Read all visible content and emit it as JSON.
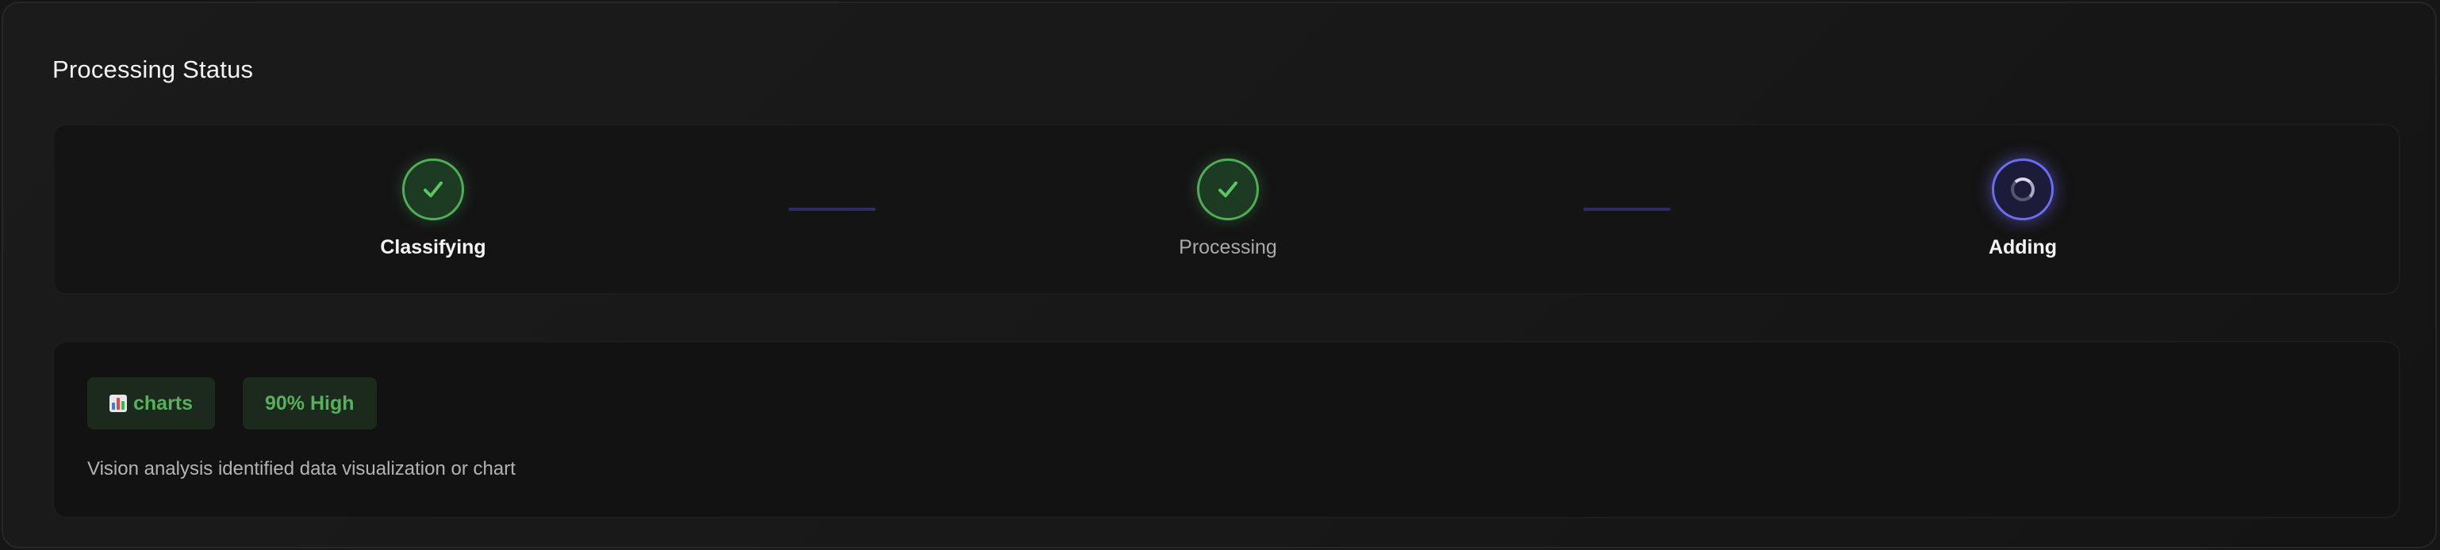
{
  "header": {
    "title": "Processing Status"
  },
  "steps": [
    {
      "label": "Classifying",
      "state": "done"
    },
    {
      "label": "Processing",
      "state": "done"
    },
    {
      "label": "Adding",
      "state": "active"
    }
  ],
  "details": {
    "badges": [
      {
        "icon": "bar-chart-icon",
        "label": "charts"
      },
      {
        "label": "90% High"
      }
    ],
    "description": "Vision analysis identified data visualization or chart"
  },
  "colors": {
    "success": "#4fae57",
    "active": "#6b6cf0",
    "badge_text": "#56b05c"
  }
}
